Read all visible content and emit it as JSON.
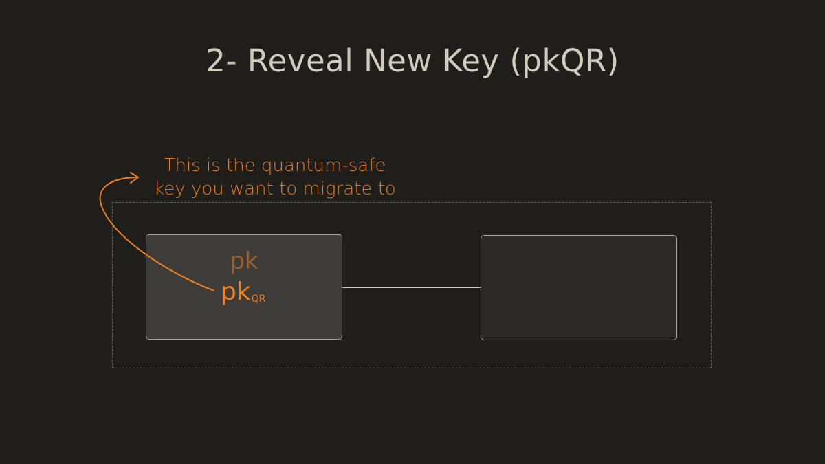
{
  "title": "2- Reveal New Key (pkQR)",
  "annotation": {
    "line1": "This is the quantum-safe",
    "line2": "key you want to migrate to"
  },
  "key_box": {
    "old_key": "pk",
    "new_key_main": "pk",
    "new_key_sub": "QR"
  },
  "colors": {
    "background": "#1f1e1b",
    "accent": "#f07f22",
    "muted_accent": "#9a5e2c",
    "text": "#cfcbbf"
  }
}
